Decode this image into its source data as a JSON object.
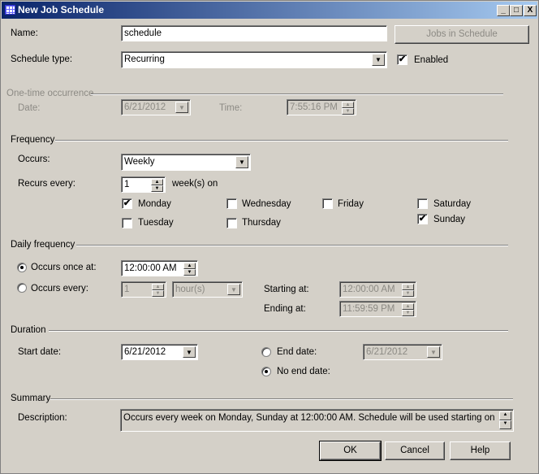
{
  "window": {
    "title": "New Job Schedule",
    "minimize": "_",
    "maximize": "□",
    "close": "X"
  },
  "name": {
    "label": "Name:",
    "value": "schedule"
  },
  "jobs_button": "Jobs in Schedule",
  "schedule_type": {
    "label": "Schedule type:",
    "value": "Recurring"
  },
  "enabled": {
    "label": "Enabled",
    "checked": true,
    "mark": "✔"
  },
  "one_time": {
    "header": "One-time occurrence",
    "date_label": "Date:",
    "date": "6/21/2012",
    "time_label": "Time:",
    "time": "7:55:16 PM"
  },
  "frequency": {
    "header": "Frequency",
    "occurs_label": "Occurs:",
    "occurs": "Weekly",
    "recurs_label": "Recurs every:",
    "recurs_value": "1",
    "recurs_unit": "week(s) on",
    "days": {
      "monday": "Monday",
      "wednesday": "Wednesday",
      "friday": "Friday",
      "saturday": "Saturday",
      "tuesday": "Tuesday",
      "thursday": "Thursday",
      "sunday": "Sunday"
    },
    "checked_days": [
      "Monday",
      "Sunday"
    ]
  },
  "daily": {
    "header": "Daily frequency",
    "once_label": "Occurs once at:",
    "once_time": "12:00:00 AM",
    "every_label": "Occurs every:",
    "every_value": "1",
    "every_unit": "hour(s)",
    "starting_label": "Starting at:",
    "starting": "12:00:00 AM",
    "ending_label": "Ending at:",
    "ending": "11:59:59 PM"
  },
  "duration": {
    "header": "Duration",
    "start_label": "Start date:",
    "start": "6/21/2012",
    "end_label": "End date:",
    "end": "6/21/2012",
    "no_end_label": "No end date:"
  },
  "summary": {
    "header": "Summary",
    "desc_label": "Description:",
    "description": "Occurs every week on Monday, Sunday at 12:00:00 AM. Schedule will be used starting on"
  },
  "buttons": {
    "ok": "OK",
    "cancel": "Cancel",
    "help": "Help"
  },
  "glyphs": {
    "down": "▼",
    "up": "▲",
    "check": "✔"
  }
}
